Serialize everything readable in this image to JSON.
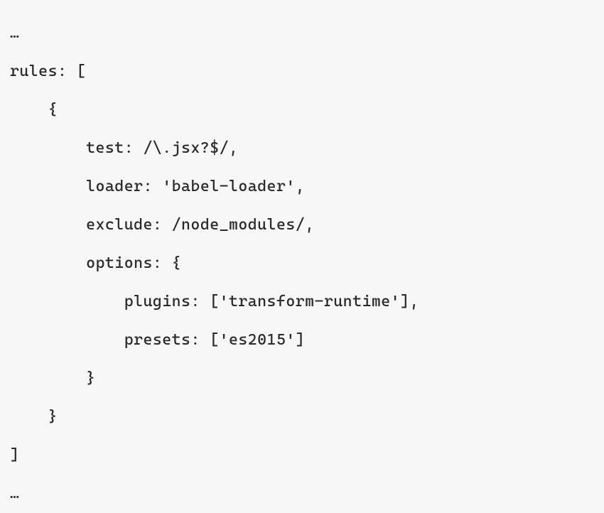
{
  "code": {
    "lines": [
      "…",
      "rules: [",
      "    {",
      "        test: /\\.jsx?$/,",
      "        loader: 'babel-loader',",
      "        exclude: /node_modules/,",
      "        options: {",
      "            plugins: ['transform-runtime'],",
      "            presets: ['es2015']",
      "        }",
      "    }",
      "]",
      "…"
    ]
  }
}
